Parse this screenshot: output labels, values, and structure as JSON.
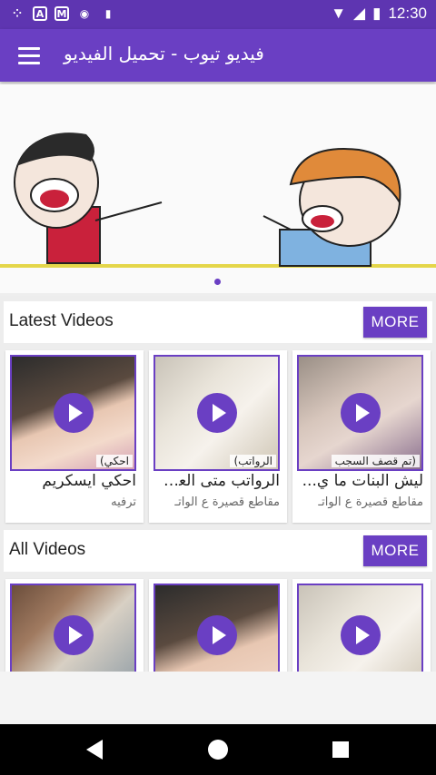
{
  "status_bar": {
    "time": "12:30",
    "icons": [
      "dots-icon",
      "font-a-icon",
      "gmail-icon",
      "sync-icon",
      "sd-card-icon"
    ],
    "right_icons": [
      "wifi-icon",
      "signal-icon",
      "battery-charging-icon"
    ]
  },
  "app_bar": {
    "title": "فيديو تيوب - تحميل الفيديو",
    "menu_icon": "hamburger-menu-icon"
  },
  "latest": {
    "title": "Latest Videos",
    "more_label": "MORE",
    "cards": [
      {
        "title": "احكي ايسكريم",
        "subtitle": "ترفيه",
        "thumb_caption": "احكي)"
      },
      {
        "title": "الرواتب متى العي...",
        "subtitle": "مقاطع قصيرة ع الواتـ",
        "thumb_caption": "الرواتب)"
      },
      {
        "title": "ليش البنات ما ي...",
        "subtitle": "مقاطع قصيرة ع الواتـ",
        "thumb_caption": "(تم قصف السجب"
      }
    ]
  },
  "all": {
    "title": "All Videos",
    "more_label": "MORE"
  },
  "colors": {
    "primary": "#6a3fc3",
    "status_bar": "#5e35b1"
  }
}
